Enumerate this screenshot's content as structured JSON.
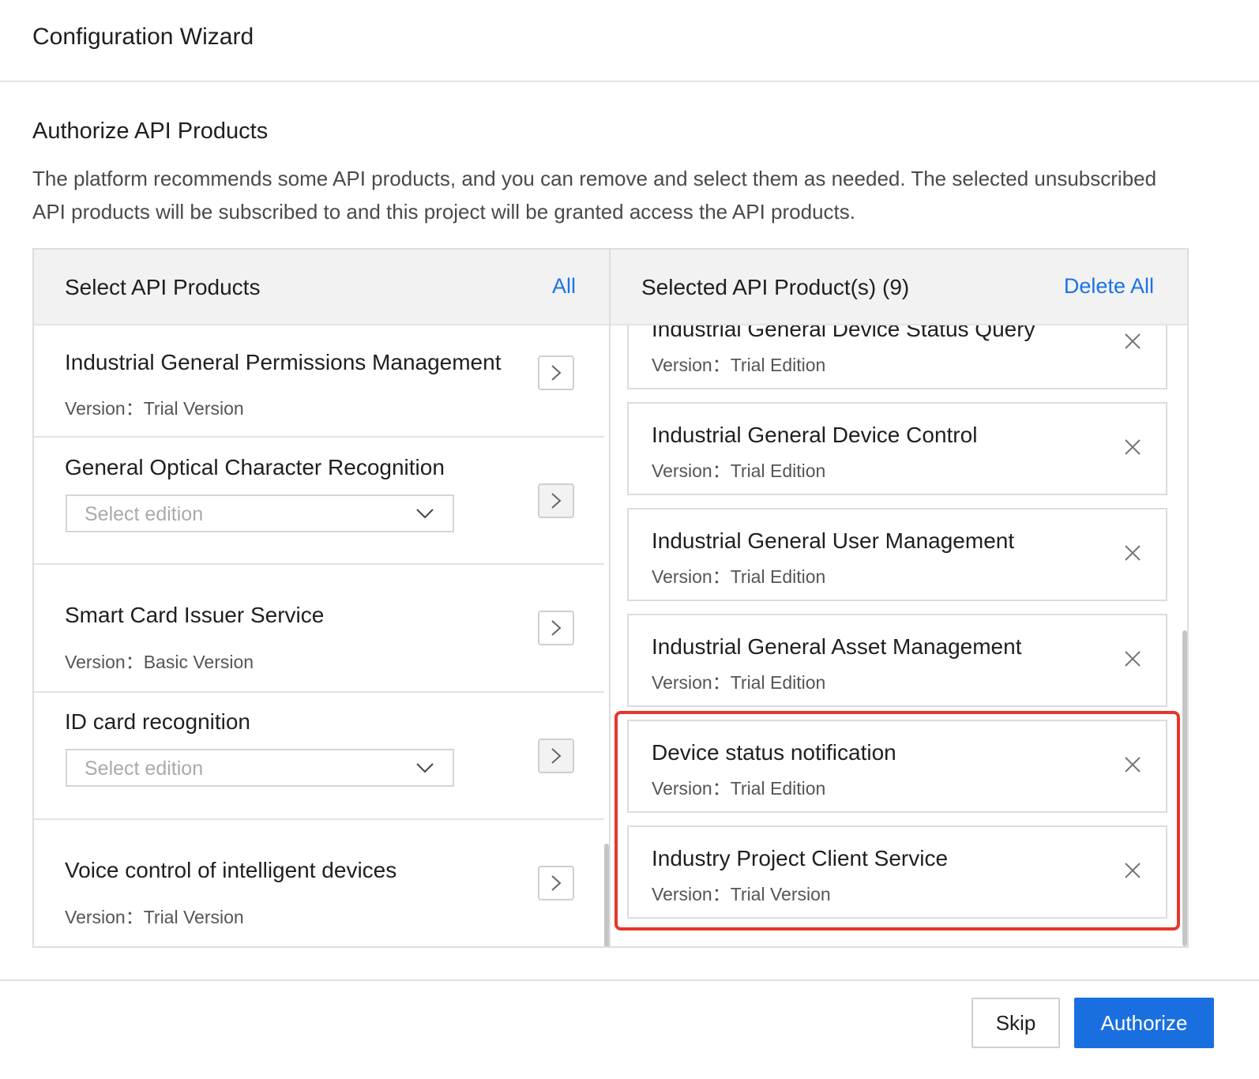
{
  "header": {
    "title": "Configuration Wizard"
  },
  "section": {
    "title": "Authorize API Products",
    "description": "The platform recommends some API products, and you can remove and select them as needed. The selected unsubscribed API products will be subscribed to and this project will be granted access the API products."
  },
  "left_panel": {
    "title": "Select API Products",
    "action": "All",
    "items": [
      {
        "name": "Industrial General Permissions Management",
        "version": "Version：Trial Version"
      },
      {
        "name": "General Optical Character Recognition",
        "select_placeholder": "Select edition"
      },
      {
        "name": "Smart Card Issuer Service",
        "version": "Version：Basic Version"
      },
      {
        "name": "ID card recognition",
        "select_placeholder": "Select edition"
      },
      {
        "name": "Voice control of intelligent devices",
        "version": "Version：Trial Version"
      }
    ]
  },
  "right_panel": {
    "title": "Selected API Product(s) (9)",
    "action": "Delete All",
    "items": [
      {
        "name": "Industrial General Device Status Query",
        "version": "Version：Trial Edition"
      },
      {
        "name": "Industrial General Device Control",
        "version": "Version：Trial Edition"
      },
      {
        "name": "Industrial General User Management",
        "version": "Version：Trial Edition"
      },
      {
        "name": "Industrial General Asset Management",
        "version": "Version：Trial Edition"
      },
      {
        "name": "Device status notification",
        "version": "Version：Trial Edition"
      },
      {
        "name": "Industry Project Client Service",
        "version": "Version：Trial Version"
      }
    ]
  },
  "footer": {
    "skip_label": "Skip",
    "authorize_label": "Authorize"
  },
  "colors": {
    "accent": "#1a6fe0",
    "link": "#1a73e8",
    "highlight": "#e8352b"
  }
}
